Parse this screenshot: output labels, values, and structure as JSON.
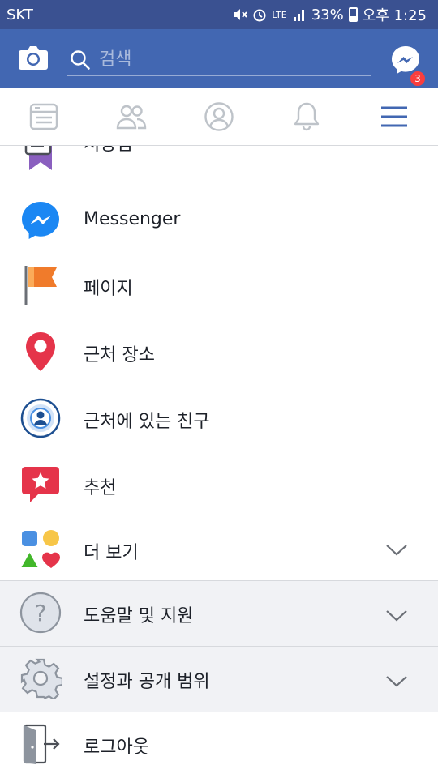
{
  "status_bar": {
    "carrier": "SKT",
    "network": "LTE",
    "battery": "33%",
    "time": "오후 1:25"
  },
  "header": {
    "search_placeholder": "검색",
    "messenger_badge": "3"
  },
  "tabs": [
    {
      "icon": "news-feed-icon"
    },
    {
      "icon": "friends-icon"
    },
    {
      "icon": "profile-icon"
    },
    {
      "icon": "notifications-icon"
    },
    {
      "icon": "menu-icon",
      "active": true
    }
  ],
  "menu": {
    "saved": "저장됨",
    "messenger": "Messenger",
    "pages": "페이지",
    "nearby_places": "근처 장소",
    "nearby_friends": "근처에 있는 친구",
    "recommendations": "추천",
    "see_more": "더 보기",
    "help_support": "도움말 및 지원",
    "settings_privacy": "설정과 공개 범위",
    "logout": "로그아웃"
  },
  "colors": {
    "brand": "#4267b2",
    "status_bar": "#3a5191",
    "badge": "#fa3e3e",
    "messenger_blue": "#1b87f3",
    "pin_red": "#e5344a",
    "flag_orange": "#f07b2b",
    "saved_purple": "#8a5fbf"
  }
}
